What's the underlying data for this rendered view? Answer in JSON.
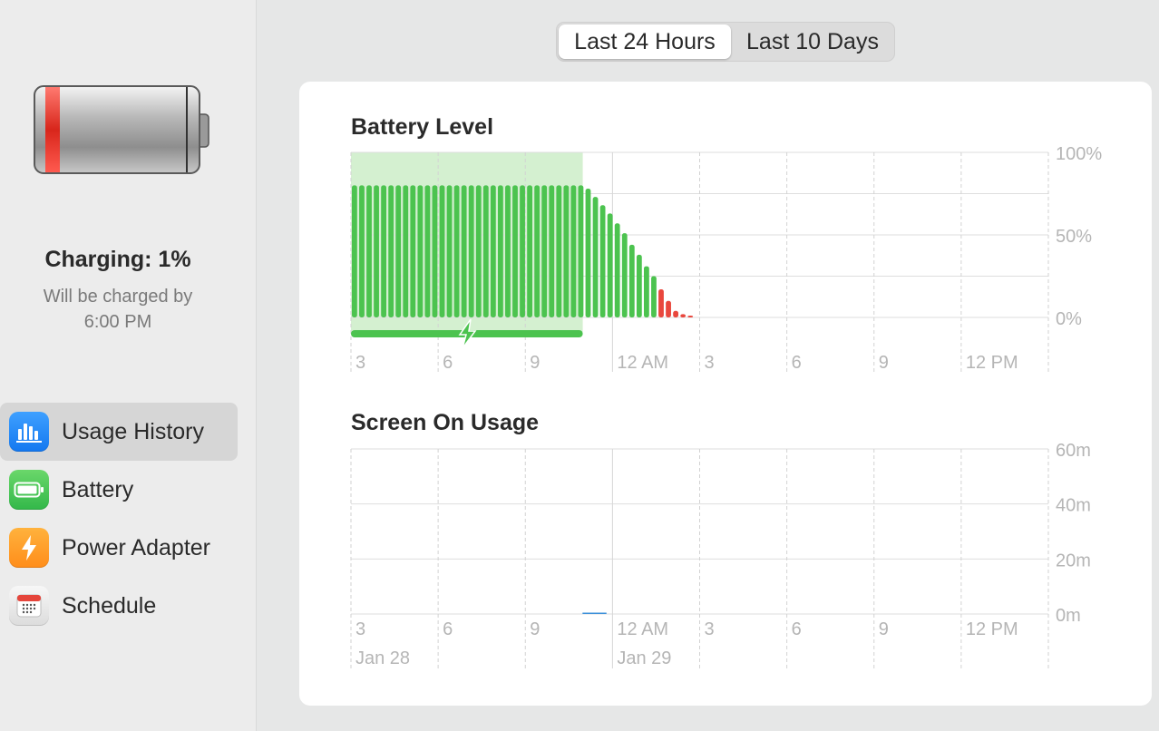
{
  "sidebar": {
    "charging_title": "Charging: 1%",
    "charging_sub_line1": "Will be charged by",
    "charging_sub_line2": "6:00 PM",
    "items": [
      {
        "label": "Usage History",
        "icon": "bar-chart-icon",
        "active": true
      },
      {
        "label": "Battery",
        "icon": "battery-icon",
        "active": false
      },
      {
        "label": "Power Adapter",
        "icon": "lightning-icon",
        "active": false
      },
      {
        "label": "Schedule",
        "icon": "calendar-icon",
        "active": false
      }
    ]
  },
  "segmented": {
    "options": [
      "Last 24 Hours",
      "Last 10 Days"
    ],
    "selected": "Last 24 Hours"
  },
  "colors": {
    "battery_green": "#4cc34f",
    "battery_low_red": "#e9473d",
    "charging_shade": "#d4f0d0",
    "screen_usage_blue": "#3b8fd9"
  },
  "chart_data": [
    {
      "type": "bar",
      "title": "Battery Level",
      "y_ticks": [
        "100%",
        "50%",
        "0%"
      ],
      "ylim": [
        0,
        100
      ],
      "x_ticks": [
        "3",
        "6",
        "9",
        "12 AM",
        "3",
        "6",
        "9",
        "12 PM"
      ],
      "charging_marker": true,
      "grid": true,
      "values": [
        80,
        80,
        80,
        80,
        80,
        80,
        80,
        80,
        80,
        80,
        80,
        80,
        80,
        80,
        80,
        80,
        80,
        80,
        80,
        80,
        80,
        80,
        80,
        80,
        80,
        80,
        80,
        80,
        80,
        80,
        80,
        80,
        78,
        73,
        68,
        63,
        57,
        51,
        44,
        38,
        31,
        25,
        17,
        10,
        4,
        2,
        1
      ]
    },
    {
      "type": "bar",
      "title": "Screen On Usage",
      "y_ticks": [
        "60m",
        "40m",
        "20m",
        "0m"
      ],
      "ylim": [
        0,
        60
      ],
      "x_ticks": [
        "3",
        "6",
        "9",
        "12 AM",
        "3",
        "6",
        "9",
        "12 PM"
      ],
      "date_labels": [
        "Jan 28",
        "Jan 29"
      ],
      "grid": true,
      "values": [
        {
          "slot": 11,
          "minutes": 0.3
        }
      ]
    }
  ]
}
